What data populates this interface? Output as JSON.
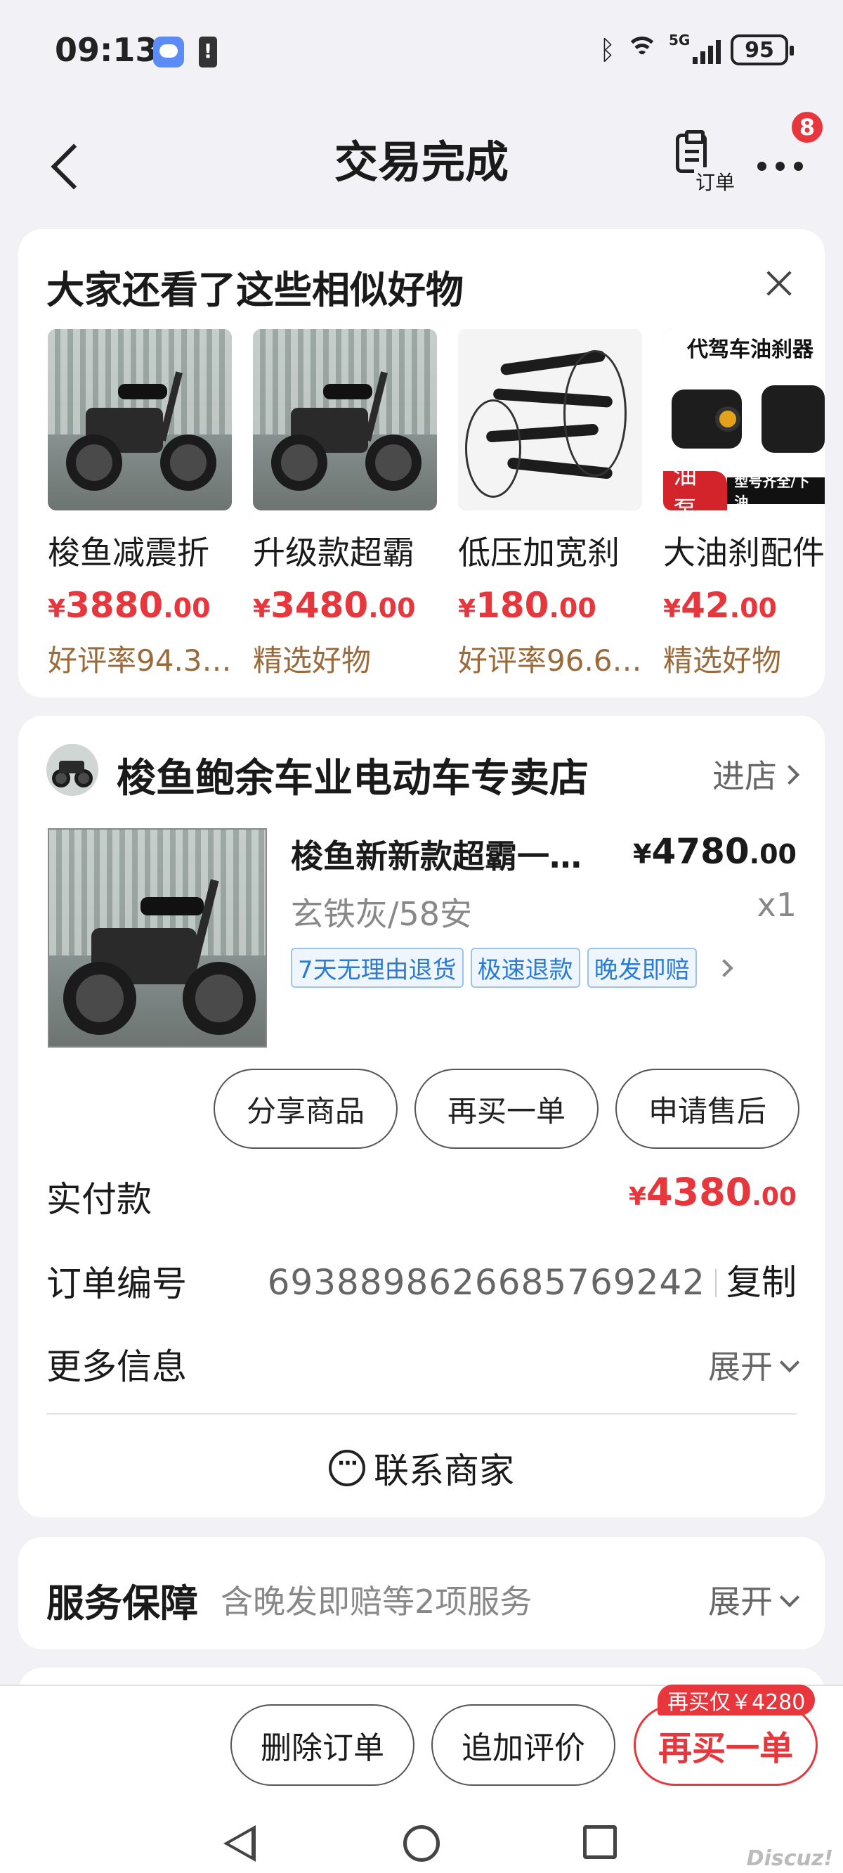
{
  "status_bar": {
    "time": "09:13",
    "network": "5G",
    "battery": "95",
    "icons": [
      "message-icon",
      "alert-icon",
      "bluetooth-icon",
      "wifi-icon",
      "signal-icon",
      "battery-icon"
    ]
  },
  "nav": {
    "title": "交易完成",
    "order_label": "订单",
    "badge": "8",
    "icons": [
      "back-arrow-icon",
      "order-clipboard-icon",
      "more-dots-icon"
    ]
  },
  "similar": {
    "title": "大家还看了这些相似好物",
    "items": [
      {
        "name": "梭鱼减震折",
        "price_int": "3880",
        "price_dec": ".00",
        "tag": "好评率94.3…",
        "image": "folding-ebike-photo"
      },
      {
        "name": "升级款超霸",
        "price_int": "3480",
        "price_dec": ".00",
        "tag": "精选好物",
        "image": "folding-ebike-photo"
      },
      {
        "name": "低压加宽刹",
        "price_int": "180",
        "price_dec": ".00",
        "tag": "好评率96.6…",
        "image": "brake-levers-photo"
      },
      {
        "name": "大油刹配件",
        "price_int": "42",
        "price_dec": ".00",
        "tag": "精选好物",
        "image": "brake-caliper-photo",
        "image_title": "代驾车油刹器",
        "image_badge": "油泵",
        "image_caption": "型号齐全/下油"
      }
    ]
  },
  "currency": "¥",
  "order": {
    "store_name": "梭鱼鲍余车业电动车专卖店",
    "enter_store": "进店",
    "product": {
      "title": "梭鱼新新款超霸一…",
      "price_int": "4780",
      "price_dec": ".00",
      "spec": "玄铁灰/58安",
      "qty": "x1",
      "tags": [
        "7天无理由退货",
        "极速退款",
        "晚发即赔"
      ]
    },
    "actions": [
      "分享商品",
      "再买一单",
      "申请售后"
    ],
    "paid_label": "实付款",
    "paid_int": "4380",
    "paid_dec": ".00",
    "order_no_label": "订单编号",
    "order_no": "6938898626685769242",
    "copy": "复制",
    "more_info_label": "更多信息",
    "expand": "展开",
    "contact": "联系商家"
  },
  "service": {
    "title": "服务保障",
    "subtitle": "含晚发即赔等2项服务",
    "expand": "展开"
  },
  "bottom": {
    "delete": "删除订单",
    "review": "追加评价",
    "rebuy": "再买一单",
    "rebuy_badge": "再买仅￥4280"
  },
  "watermark": "Discuz!",
  "colors": {
    "accent_red": "#e8363d",
    "tag_blue": "#2a7bd8",
    "tag_brown": "#9a6a3a",
    "background": "#f2f2f6"
  }
}
